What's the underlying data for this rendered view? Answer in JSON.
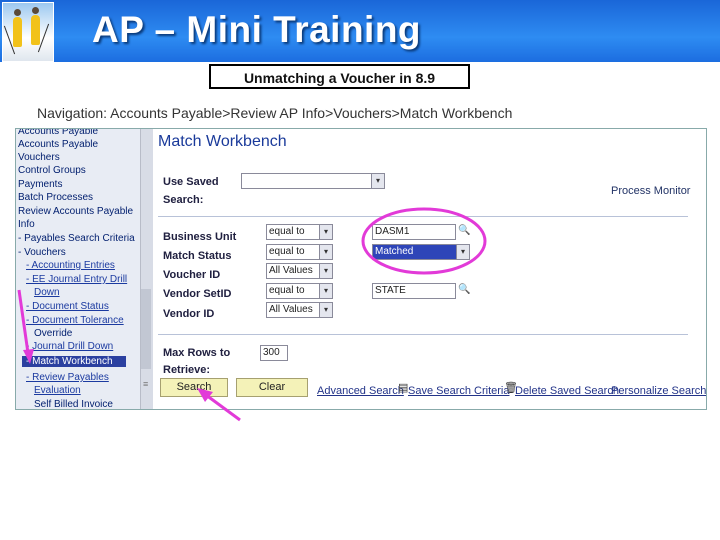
{
  "slide": {
    "title": "AP – Mini Training",
    "subtitle": "Unmatching a Voucher in 8.9",
    "navigation": "Navigation: Accounts Payable>Review AP Info>Vouchers>Match Workbench"
  },
  "sidebar": {
    "items": [
      {
        "label": "Accounts Payable",
        "link": false
      },
      {
        "label": "Vouchers",
        "link": false
      },
      {
        "label": "Control Groups",
        "link": false
      },
      {
        "label": "Payments",
        "link": false
      },
      {
        "label": "Batch Processes",
        "link": false
      },
      {
        "label": "Review Accounts Payable",
        "link": false
      },
      {
        "label": "Info",
        "link": false
      },
      {
        "label": "- Payables Search Criteria",
        "link": false
      },
      {
        "label": "- Vouchers",
        "link": false
      },
      {
        "label": "- Accounting Entries",
        "link": true
      },
      {
        "label": "- EE Journal Entry Drill",
        "link": true
      },
      {
        "label": "Down",
        "link": true
      },
      {
        "label": "- Document Status",
        "link": true
      },
      {
        "label": "- Document Tolerance",
        "link": true
      },
      {
        "label": "- Journal Drill Down",
        "link": true
      },
      {
        "label": "- Match Workbench",
        "link": true,
        "selected": true
      },
      {
        "label": "- Review Payables",
        "link": true
      },
      {
        "label": "Evaluation",
        "link": true
      },
      {
        "label": "Self Billed Invoice",
        "link": false
      }
    ]
  },
  "workbench": {
    "title": "Match Workbench",
    "use_saved_label": "Use Saved",
    "search_label": "Search:",
    "process_monitor": "Process Monitor",
    "business_unit_label": "Business Unit",
    "match_status_label": "Match Status",
    "voucher_id_label": "Voucher ID",
    "vendor_setid_label": "Vendor SetID",
    "vendor_id_label": "Vendor ID",
    "bu_operator": "equal to",
    "ms_operator": "equal to",
    "voucher_operator": "All Values",
    "setid_operator": "equal to",
    "vendor_operator": "All Values",
    "bu_value": "DASM1",
    "ms_value": "Matched",
    "setid_value": "STATE",
    "max_rows_label": "Max Rows to",
    "retrieve_label": "Retrieve:",
    "max_rows_value": "300",
    "search_button": "Search",
    "clear_button": "Clear",
    "advanced_search": "Advanced Search",
    "save_search": "Save Search Criteria",
    "delete_search": "Delete Saved Search",
    "personalize_search": "Personalize Search"
  },
  "colors": {
    "header_blue": "#2e8cf2",
    "annotation_magenta": "#e23ad8",
    "selected_nav": "#2b40a0",
    "button_yellow": "#f4f2b8"
  }
}
